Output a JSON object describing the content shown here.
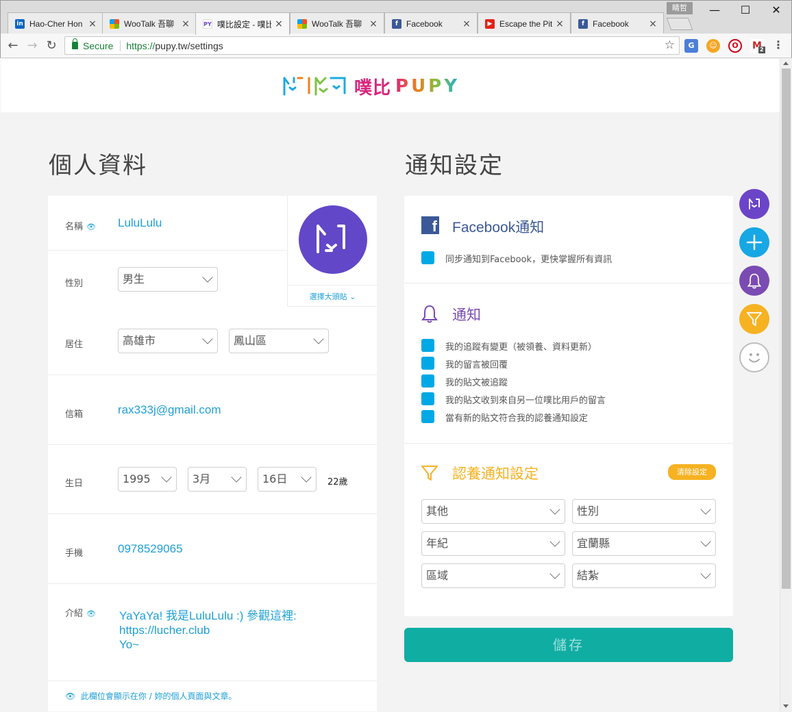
{
  "browser": {
    "tabs": [
      {
        "title": "Hao-Cher Hon",
        "icon": "linkedin-icon"
      },
      {
        "title": "WooTalk 吾聊",
        "icon": "microsoft-icon"
      },
      {
        "title": "噗比設定 - 噗比",
        "icon": "pupy-icon",
        "active": true
      },
      {
        "title": "WooTalk 吾聊",
        "icon": "microsoft-icon"
      },
      {
        "title": "Facebook",
        "icon": "facebook-icon"
      },
      {
        "title": "Escape the Pit",
        "icon": "youtube-icon"
      },
      {
        "title": "Facebook",
        "icon": "facebook-icon"
      }
    ],
    "profile_label": "睛哲",
    "secure_label": "Secure",
    "url_scheme": "https://",
    "url_rest": "pupy.tw/settings",
    "gmail_badge": "2"
  },
  "site": {
    "brand_chinese": "噗比",
    "brand_latin": "PUPY"
  },
  "profile": {
    "section_title": "個人資料",
    "name_label": "名稱",
    "name_value": "LuluLulu",
    "gender_label": "性別",
    "gender_value": "男生",
    "avatar_link": "選擇大頭貼",
    "residence_label": "居住",
    "city_value": "高雄市",
    "district_value": "鳳山區",
    "email_label": "信箱",
    "email_value": "rax333j@gmail.com",
    "birthday_label": "生日",
    "year_value": "1995",
    "month_value": "3月",
    "day_value": "16日",
    "age_text": "22歲",
    "phone_label": "手機",
    "phone_value": "0978529065",
    "intro_label": "介紹",
    "intro_line1": "YaYaYa! 我是LuluLulu :) 參觀這裡:",
    "intro_line2": "https://lucher.club",
    "intro_line3": "Yo~",
    "footnote": "此欄位會顯示在你 / 妳的個人頁面與文章。"
  },
  "notify": {
    "section_title": "通知設定",
    "facebook_title": "Facebook通知",
    "facebook_options": [
      "同步通知到Facebook，更快掌握所有資訊"
    ],
    "notify_title": "通知",
    "notify_options": [
      "我的追蹤有變更（被領養、資料更新）",
      "我的留言被回覆",
      "我的貼文被追蹤",
      "我的貼文收到來自另一位噗比用戶的留言",
      "當有新的貼文符合我的認養通知設定"
    ],
    "adopt_title": "認養通知設定",
    "clear_label": "清除設定",
    "filters": {
      "species": "其他",
      "sex": "性別",
      "age": "年紀",
      "county": "宜蘭縣",
      "area": "區域",
      "neuter": "結紮"
    },
    "save_label": "儲存"
  },
  "colors": {
    "accent_blue": "#1e9fd7",
    "checkbox_blue": "#00a8e6",
    "facebook_blue": "#3b5998",
    "purple": "#6b45c8",
    "orange": "#f6b221",
    "teal": "#10ada3"
  }
}
